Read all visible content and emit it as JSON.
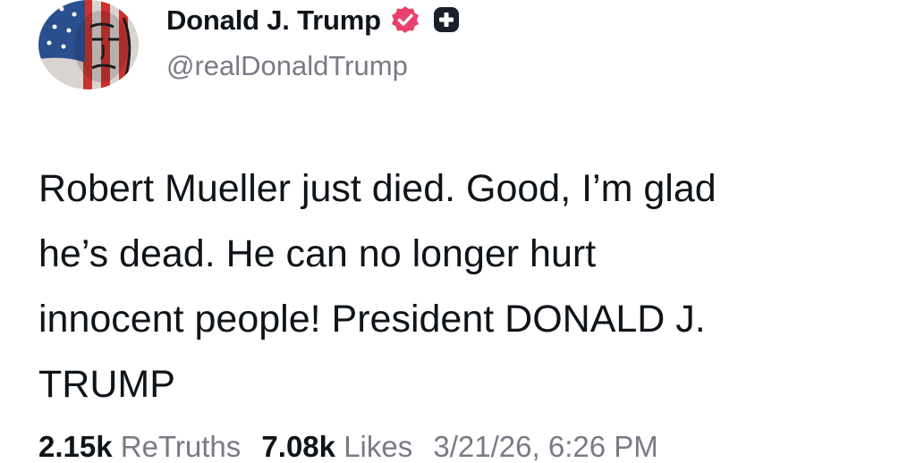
{
  "profile": {
    "display_name": "Donald J. Trump",
    "handle": "@realDonaldTrump",
    "avatar_icon": "american-flag-portrait-icon",
    "verified_icon": "verified-badge-icon",
    "verified_color": "#e8416f",
    "plus_icon": "plus-badge-icon"
  },
  "post": {
    "lines": [
      "Robert Mueller just died. Good, I’m glad",
      "he’s dead. He can no longer hurt",
      "innocent people! President DONALD J.",
      "TRUMP"
    ]
  },
  "stats": {
    "retruths_count": "2.15k",
    "retruths_label": "ReTruths",
    "likes_count": "7.08k",
    "likes_label": "Likes",
    "timestamp": "3/21/26, 6:26 PM"
  }
}
